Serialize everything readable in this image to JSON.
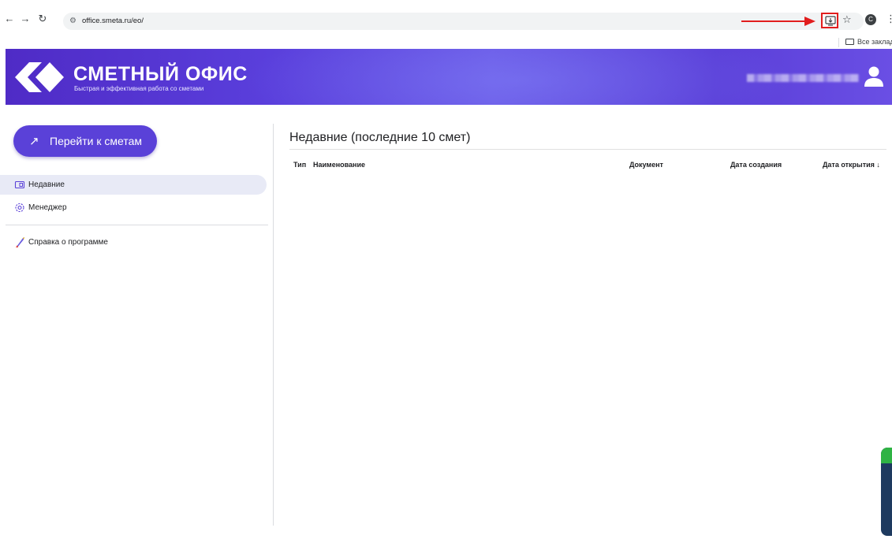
{
  "browser": {
    "url": "office.smeta.ru/eo/",
    "profile_initial": "C",
    "bookmarks_label": "Все закладки"
  },
  "header": {
    "brand_title": "СМЕТНЫЙ ОФИС",
    "brand_subtitle": "Быстрая и эффективная работа со сметами"
  },
  "sidebar": {
    "goto_button": "Перейти к сметам",
    "items": [
      {
        "label": "Недавние",
        "icon": "folder-recent-icon",
        "active": true
      },
      {
        "label": "Менеджер",
        "icon": "gear-icon",
        "active": false
      },
      {
        "label": "Справка о программе",
        "icon": "rocket-icon",
        "active": false
      }
    ]
  },
  "main": {
    "title": "Недавние (последние 10 смет)",
    "columns": [
      "Тип",
      "Наименование",
      "Документ",
      "Дата создания",
      "Дата открытия ↓"
    ]
  },
  "colors": {
    "accent": "#5a41d8",
    "annotation": "#e11d1d"
  }
}
